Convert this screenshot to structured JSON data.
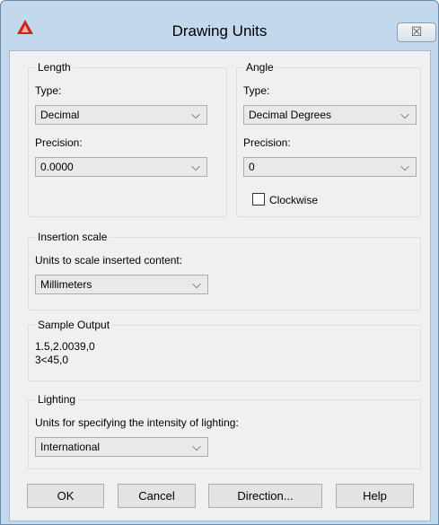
{
  "window": {
    "title": "Drawing Units",
    "close_glyph": "☒"
  },
  "length": {
    "legend": "Length",
    "type_label": "Type:",
    "type_value": "Decimal",
    "precision_label": "Precision:",
    "precision_value": "0.0000"
  },
  "angle": {
    "legend": "Angle",
    "type_label": "Type:",
    "type_value": "Decimal Degrees",
    "precision_label": "Precision:",
    "precision_value": "0",
    "clockwise_label": "Clockwise",
    "clockwise_checked": false
  },
  "insertion": {
    "legend": "Insertion scale",
    "label": "Units to scale inserted content:",
    "value": "Millimeters"
  },
  "sample": {
    "legend": "Sample Output",
    "line1": "1.5,2.0039,0",
    "line2": "3<45,0"
  },
  "lighting": {
    "legend": "Lighting",
    "label": "Units for specifying the intensity of lighting:",
    "value": "International"
  },
  "buttons": {
    "ok": "OK",
    "cancel": "Cancel",
    "direction": "Direction...",
    "help": "Help"
  },
  "icons": {
    "app": "autocad-logo-icon",
    "dropdown": "chevron-down-icon",
    "close": "close-icon"
  },
  "colors": {
    "brand": "#d0241c",
    "frame": "#c3d8ec"
  }
}
